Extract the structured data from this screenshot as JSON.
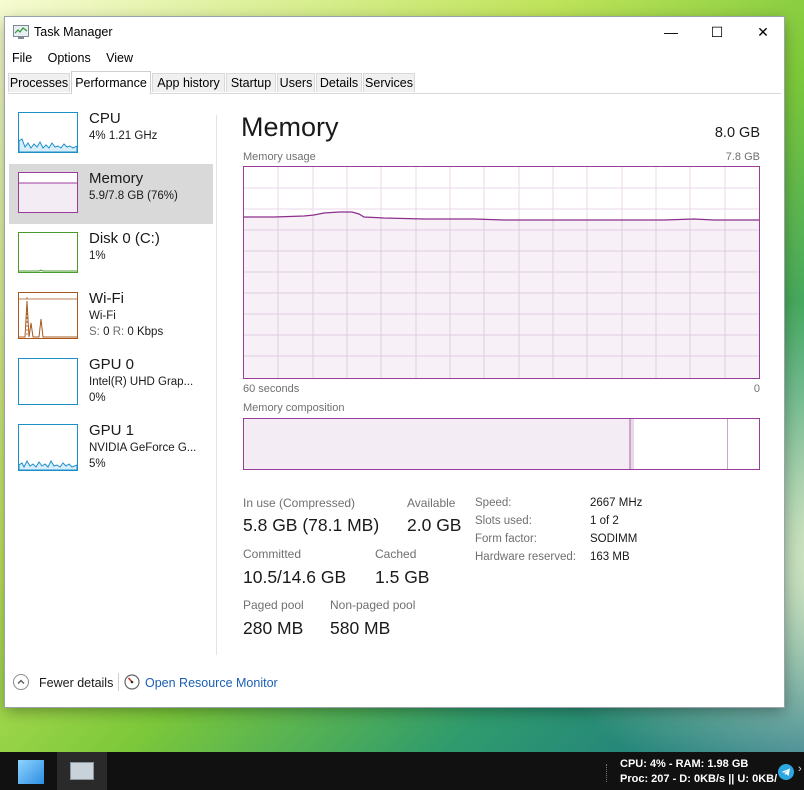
{
  "window": {
    "title": "Task Manager",
    "controls": {
      "minimize": "—",
      "maximize": "☐",
      "close": "✕"
    }
  },
  "menu": [
    "File",
    "Options",
    "View"
  ],
  "tabs": [
    "Processes",
    "Performance",
    "App history",
    "Startup",
    "Users",
    "Details",
    "Services"
  ],
  "active_tab": "Performance",
  "sidebar": [
    {
      "title": "CPU",
      "sub": "4% 1.21 GHz",
      "color": "#1c8fc9"
    },
    {
      "title": "Memory",
      "sub": "5.9/7.8 GB (76%)",
      "color": "#9b3c9b"
    },
    {
      "title": "Disk 0 (C:)",
      "sub": "1%",
      "color": "#4a9b2f"
    },
    {
      "title": "Wi-Fi",
      "sub": "Wi-Fi",
      "sub2_s": "S:",
      "sub2_s_val": "0",
      "sub2_r": "R:",
      "sub2_r_val": "0 Kbps",
      "color": "#a8581c"
    },
    {
      "title": "GPU 0",
      "sub": "Intel(R) UHD Grap...",
      "sub2": "0%",
      "color": "#1c8fc9"
    },
    {
      "title": "GPU 1",
      "sub": "NVIDIA GeForce G...",
      "sub2": "5%",
      "color": "#1c8fc9"
    }
  ],
  "main": {
    "title": "Memory",
    "total": "8.0 GB",
    "usage_label": "Memory usage",
    "usage_max": "7.8 GB",
    "time_left": "60 seconds",
    "time_right": "0",
    "composition_label": "Memory composition",
    "usage_fraction": 0.76
  },
  "stats": {
    "in_use_label": "In use (Compressed)",
    "in_use_value": "5.8 GB (78.1 MB)",
    "available_label": "Available",
    "available_value": "2.0 GB",
    "committed_label": "Committed",
    "committed_value": "10.5/14.6 GB",
    "cached_label": "Cached",
    "cached_value": "1.5 GB",
    "paged_label": "Paged pool",
    "paged_value": "280 MB",
    "nonpaged_label": "Non-paged pool",
    "nonpaged_value": "580 MB"
  },
  "properties": [
    {
      "label": "Speed:",
      "value": "2667 MHz"
    },
    {
      "label": "Slots used:",
      "value": "1 of 2"
    },
    {
      "label": "Form factor:",
      "value": "SODIMM"
    },
    {
      "label": "Hardware reserved:",
      "value": "163 MB"
    }
  ],
  "footer": {
    "fewer_details": "Fewer details",
    "resource_monitor": "Open Resource Monitor"
  },
  "taskbar": {
    "tray_line1": "CPU: 4% - RAM: 1.98 GB",
    "tray_line2": "Proc: 207 - D: 0KB/s || U: 0KB/",
    "tray_more": "›"
  }
}
